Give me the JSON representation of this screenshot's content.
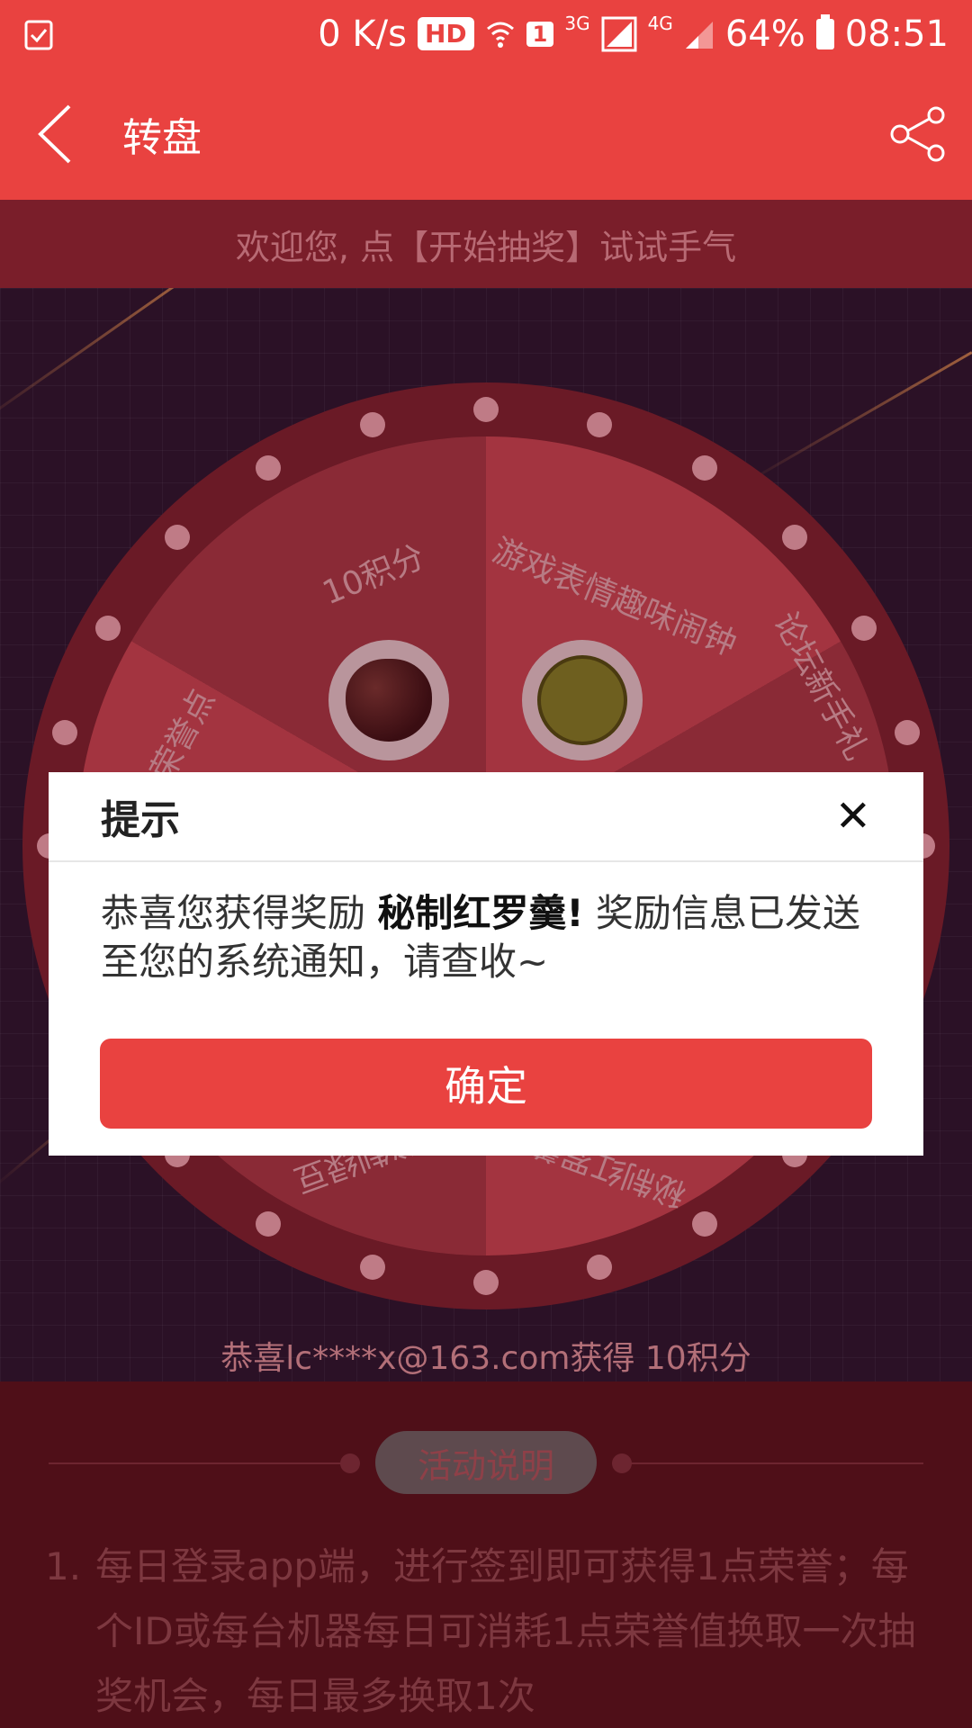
{
  "statusbar": {
    "speed": "0 K/s",
    "hd": "HD",
    "sim": "1",
    "net3g": "3G",
    "net4g": "4G",
    "battery": "64%",
    "time": "08:51"
  },
  "navbar": {
    "title": "转盘"
  },
  "welcome": "欢迎您, 点【开始抽奖】试试手气",
  "wheel": {
    "labels": [
      "10积分",
      "游戏表情趣味闹钟",
      "论坛新手礼",
      "秘制红罗羹",
      "秘制绿豆",
      "点荣誉点"
    ]
  },
  "congrats": "恭喜lc****x@163.com获得 10积分",
  "activity": {
    "title": "活动说明",
    "rule_num": "1.",
    "rule_text": "每日登录app端，进行签到即可获得1点荣誉；每个ID或每台机器每日可消耗1点荣誉值换取一次抽奖机会，每日最多换取1次"
  },
  "dialog": {
    "title": "提示",
    "close": "✕",
    "msg_prefix": "恭喜您获得奖励 ",
    "msg_prize": "秘制红罗羹!",
    "msg_suffix": " 奖励信息已发送至您的系统通知，请查收~",
    "confirm": "确定"
  }
}
